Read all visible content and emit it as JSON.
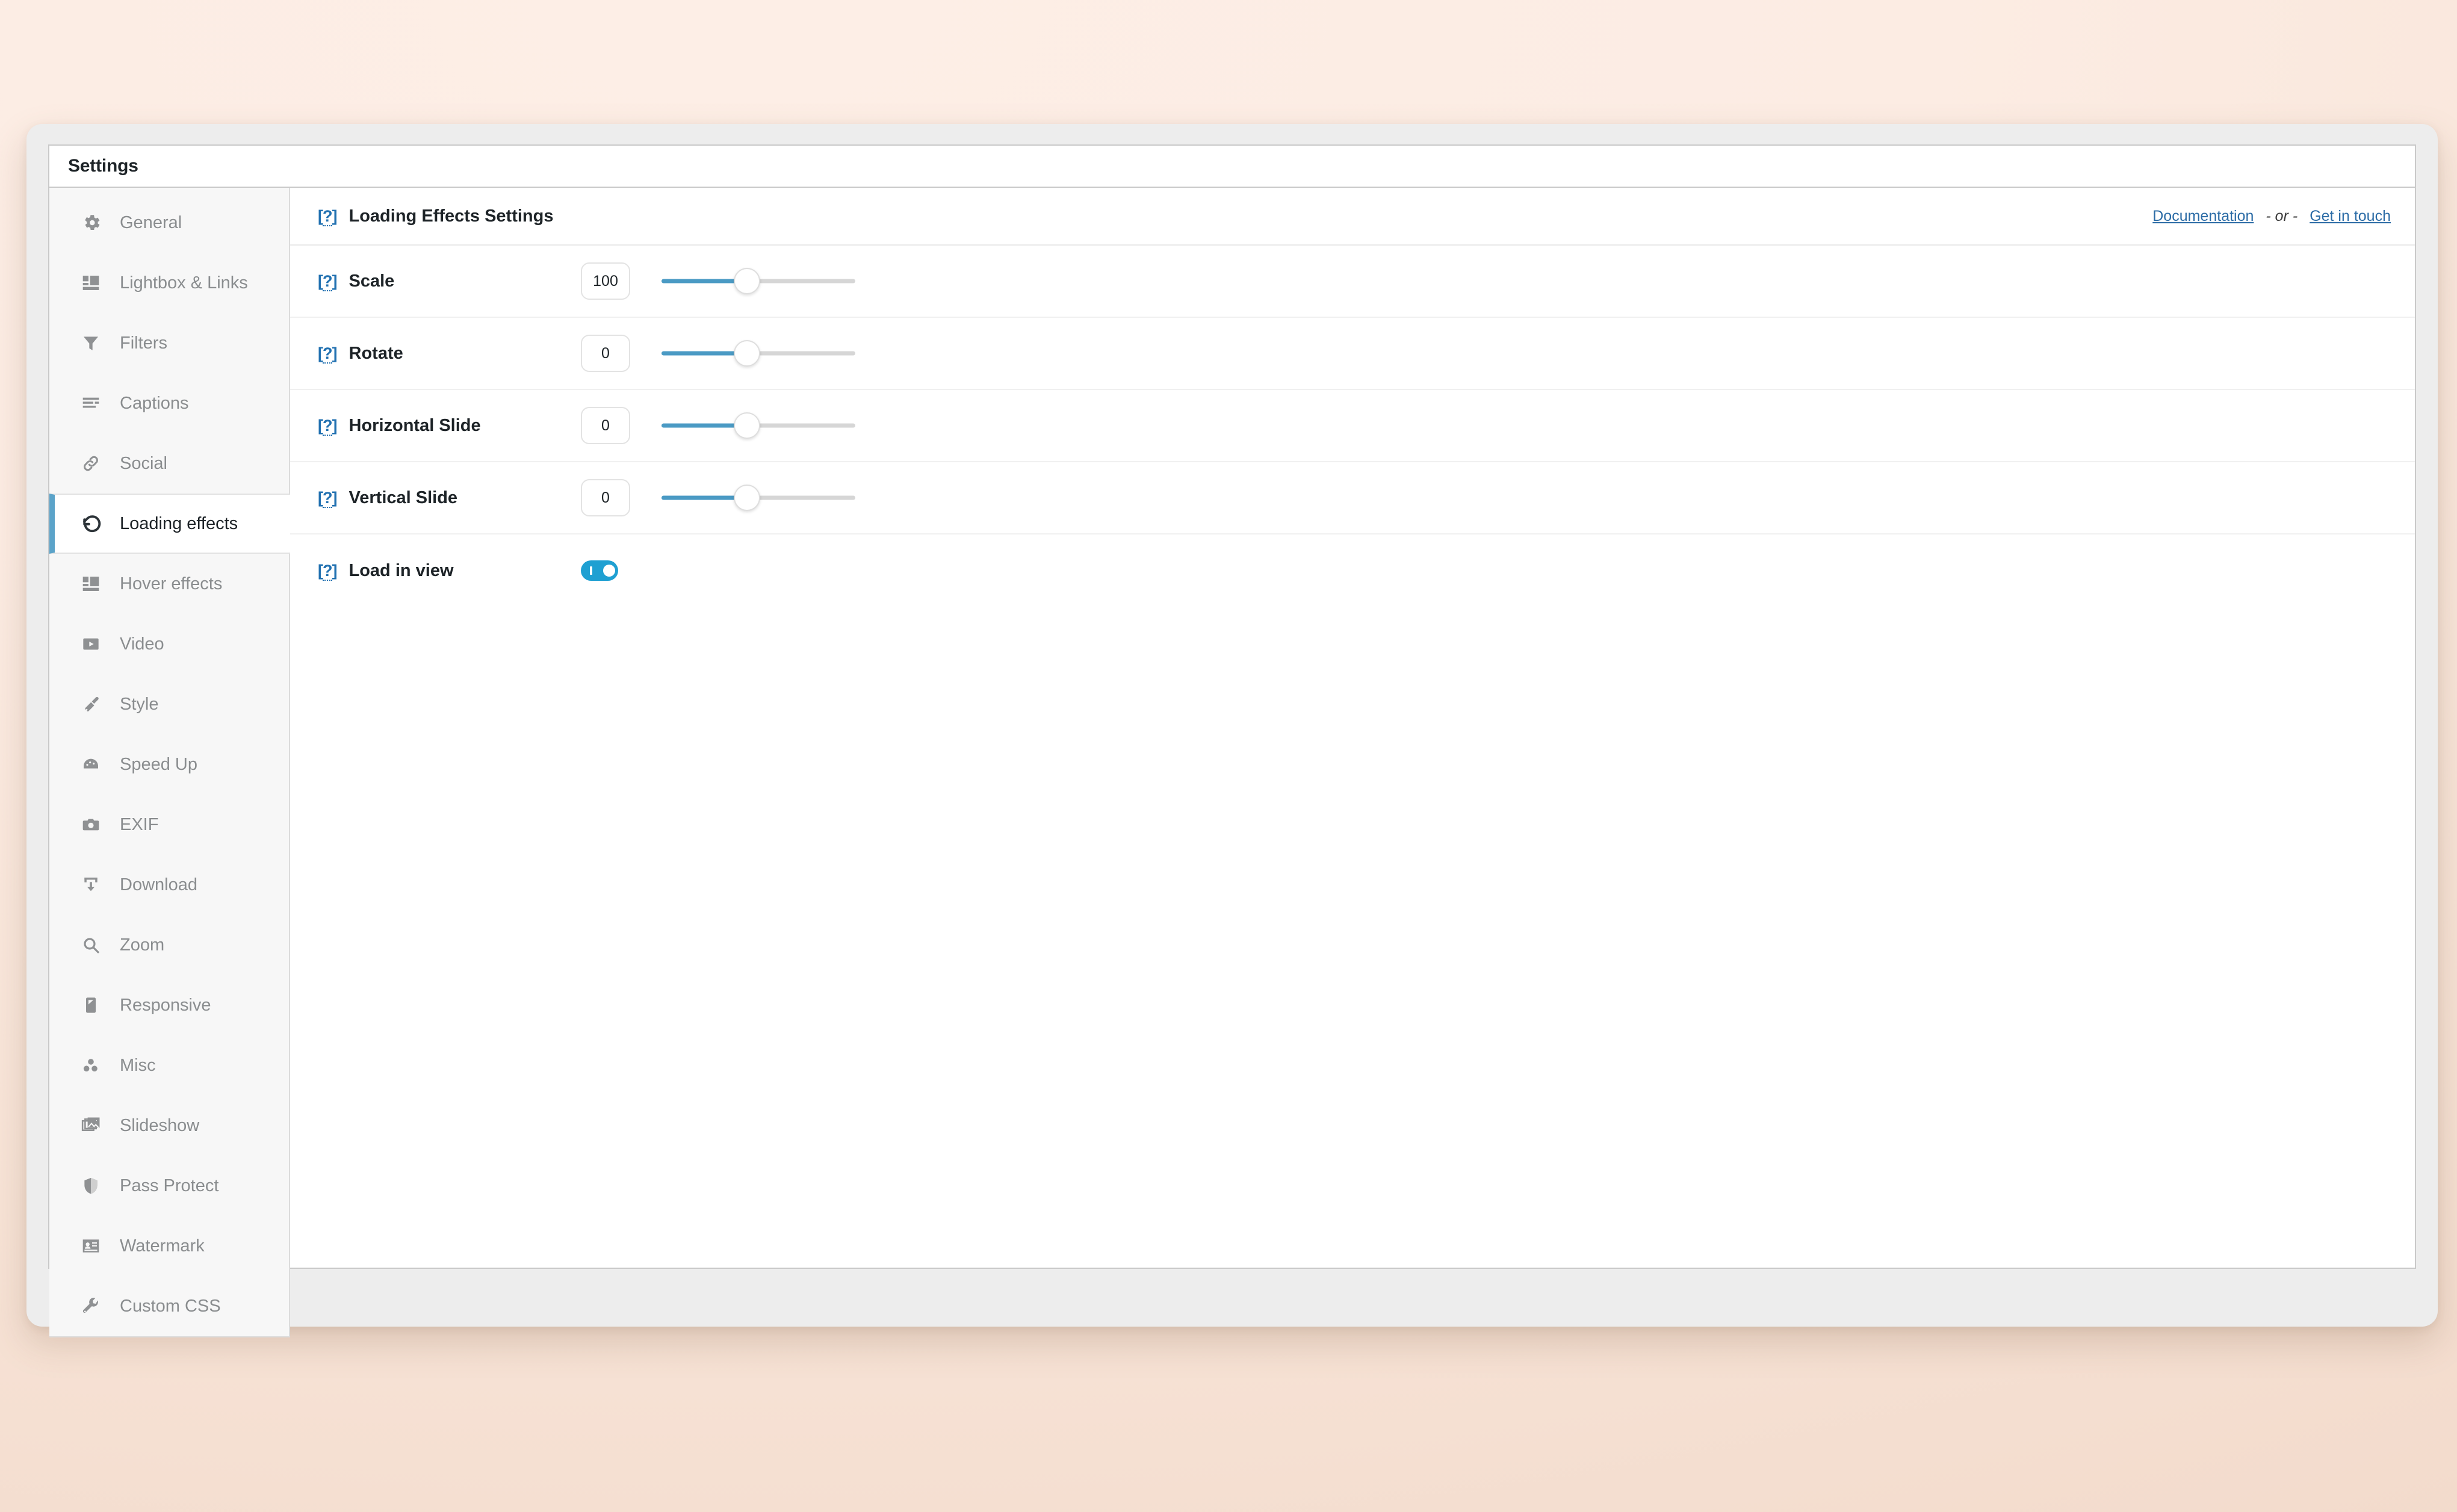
{
  "window": {
    "panel_title": "Settings"
  },
  "sidebar": {
    "items": [
      {
        "label": "General",
        "icon": "gear-icon",
        "active": false
      },
      {
        "label": "Lightbox & Links",
        "icon": "layout-icon",
        "active": false
      },
      {
        "label": "Filters",
        "icon": "funnel-icon",
        "active": false
      },
      {
        "label": "Captions",
        "icon": "text-lines-icon",
        "active": false
      },
      {
        "label": "Social",
        "icon": "link-icon",
        "active": false
      },
      {
        "label": "Loading effects",
        "icon": "rotate-ccw-icon",
        "active": true
      },
      {
        "label": "Hover effects",
        "icon": "layout-icon",
        "active": false
      },
      {
        "label": "Video",
        "icon": "play-box-icon",
        "active": false
      },
      {
        "label": "Style",
        "icon": "paint-brush-icon",
        "active": false
      },
      {
        "label": "Speed Up",
        "icon": "gauge-icon",
        "active": false
      },
      {
        "label": "EXIF",
        "icon": "camera-icon",
        "active": false
      },
      {
        "label": "Download",
        "icon": "download-icon",
        "active": false
      },
      {
        "label": "Zoom",
        "icon": "magnifier-icon",
        "active": false
      },
      {
        "label": "Responsive",
        "icon": "mobile-icon",
        "active": false
      },
      {
        "label": "Misc",
        "icon": "dots-cluster-icon",
        "active": false
      },
      {
        "label": "Slideshow",
        "icon": "images-stack-icon",
        "active": false
      },
      {
        "label": "Pass Protect",
        "icon": "shield-icon",
        "active": false
      },
      {
        "label": "Watermark",
        "icon": "id-card-icon",
        "active": false
      },
      {
        "label": "Custom CSS",
        "icon": "wrench-icon",
        "active": false
      }
    ]
  },
  "content": {
    "header": {
      "help_marker": "[?]",
      "title": "Loading Effects Settings",
      "documentation_link": "Documentation",
      "separator_text": "- or -",
      "contact_link": "Get in touch"
    },
    "help_marker": "[?]",
    "rows": [
      {
        "label": "Scale",
        "control": "slider",
        "value": "100",
        "fill_percent": 44
      },
      {
        "label": "Rotate",
        "control": "slider",
        "value": "0",
        "fill_percent": 44
      },
      {
        "label": "Horizontal Slide",
        "control": "slider",
        "value": "0",
        "fill_percent": 44
      },
      {
        "label": "Vertical Slide",
        "control": "slider",
        "value": "0",
        "fill_percent": 44
      },
      {
        "label": "Load in view",
        "control": "toggle",
        "value": "on"
      }
    ]
  },
  "colors": {
    "accent_blue": "#2271b1",
    "link_blue": "#2c6ca6",
    "slider_fill": "#4a9ac4",
    "slider_track": "#d6d6d6",
    "toggle_on": "#1fa0d2",
    "active_border": "#5ba3c9",
    "sidebar_bg": "#f7f7f7",
    "page_bg": "#fcece3"
  }
}
